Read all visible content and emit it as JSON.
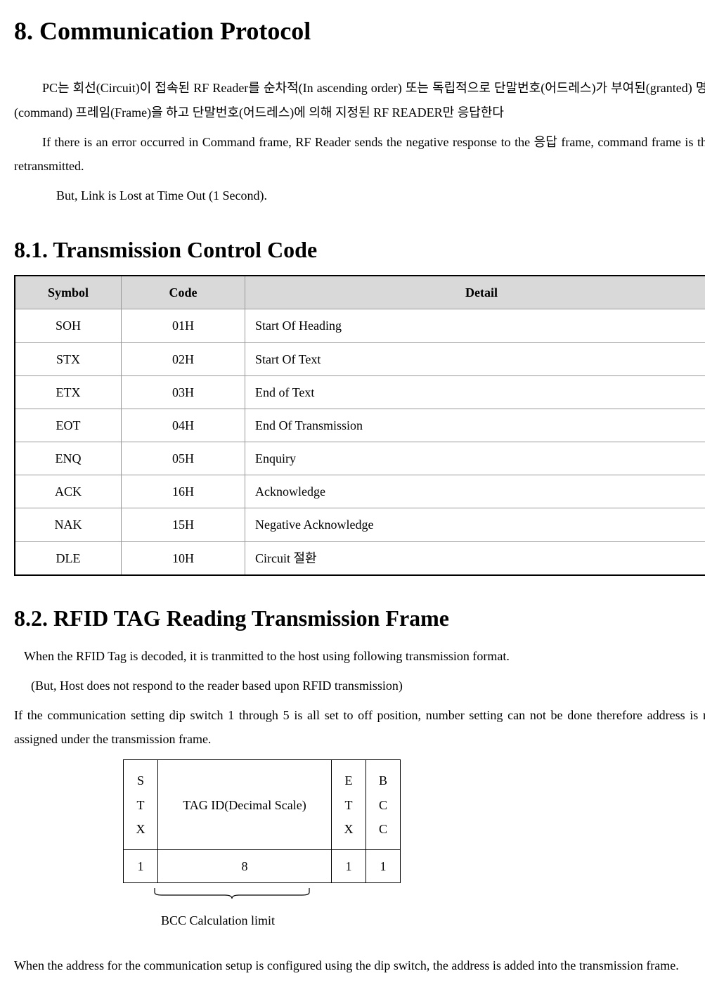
{
  "headings": {
    "h8": "8. Communication Protocol",
    "h81": "8.1. Transmission Control Code",
    "h82": "8.2. RFID TAG Reading Transmission Frame"
  },
  "intro": {
    "p1": "PC는   회선(Circuit)이   접속된   RF   Reader를   순차적(In   ascending   order)   또는   독립적으로 단말번호(어드레스)가  부여된(granted)  명령(command)  프레임(Frame)을    하고  단말번호(어드레스)에    의해 지정된  RF READER만  응답한다",
    "p2": "If there is an error occurred in Command frame, RF Reader sends the negative response to the 응답 frame, command frame is then retransmitted.",
    "p3": "But, Link is Lost at Time Out (1 Second)."
  },
  "table81": {
    "headers": {
      "symbol": "Symbol",
      "code": "Code",
      "detail": "Detail"
    },
    "rows": [
      {
        "symbol": "SOH",
        "code": "01H",
        "detail": "Start Of Heading"
      },
      {
        "symbol": "STX",
        "code": "02H",
        "detail": "Start Of Text"
      },
      {
        "symbol": "ETX",
        "code": "03H",
        "detail": "End of Text"
      },
      {
        "symbol": "EOT",
        "code": "04H",
        "detail": "End Of     Transmission"
      },
      {
        "symbol": "ENQ",
        "code": "05H",
        "detail": "Enquiry"
      },
      {
        "symbol": "ACK",
        "code": "16H",
        "detail": "Acknowledge"
      },
      {
        "symbol": "NAK",
        "code": "15H",
        "detail": "Negative Acknowledge"
      },
      {
        "symbol": "DLE",
        "code": "10H",
        "detail": "Circuit  절환"
      }
    ]
  },
  "section82": {
    "p1": "When the RFID Tag is decoded, it is tranmitted to the host using following transmission format.",
    "p2": "(But, Host does not respond to the reader based upon RFID transmission)",
    "p3": "If the communication setting dip switch 1 through 5 is all set to off position, number setting can not be done therefore address is not assigned under the transmission frame.",
    "p4": "When the address for the communication setup is configured using the dip switch, the address is added into the transmission frame."
  },
  "frame": {
    "cells": {
      "stx": "S\nT\nX",
      "tag": "TAG ID(Decimal Scale)",
      "etx": "E\nT\nX",
      "bcc": "B\nC\nC",
      "b_stx": "1",
      "b_tag": "8",
      "b_etx": "1",
      "b_bcc": "1"
    },
    "label": "BCC Calculation limit"
  }
}
